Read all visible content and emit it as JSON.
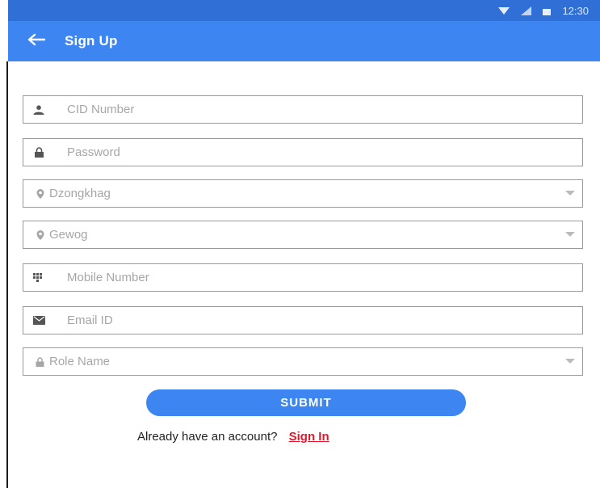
{
  "status_bar": {
    "time": "12:30",
    "icons": [
      "wifi-icon",
      "signal-icon",
      "battery-icon"
    ]
  },
  "app_bar": {
    "title": "Sign Up",
    "back_icon": "arrow-left-icon"
  },
  "form": {
    "cid": {
      "placeholder": "CID Number",
      "icon": "person-icon"
    },
    "password": {
      "placeholder": "Password",
      "icon": "lock-icon"
    },
    "dzongkhag": {
      "label": "Dzongkhag",
      "icon": "location-pin-icon"
    },
    "gewog": {
      "label": "Gewog",
      "icon": "location-pin-icon"
    },
    "mobile": {
      "placeholder": "Mobile Number",
      "icon": "dialpad-icon"
    },
    "email": {
      "placeholder": "Email ID",
      "icon": "envelope-icon"
    },
    "role": {
      "label": "Role Name",
      "icon": "lock-icon"
    }
  },
  "submit_label": "SUBMIT",
  "footer": {
    "prompt": "Already have an account?",
    "link": "Sign In"
  },
  "colors": {
    "app_bar": "#3d86f2",
    "status_bar": "#2f6fd6",
    "link": "#e2192b"
  }
}
